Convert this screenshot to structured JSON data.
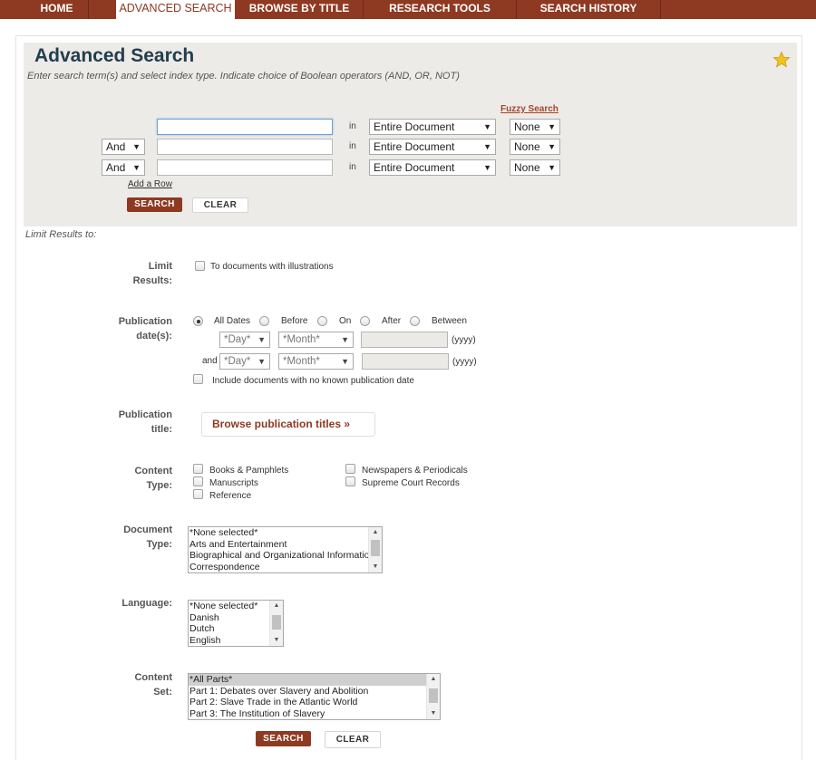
{
  "nav": {
    "tabs": [
      {
        "label": "HOME"
      },
      {
        "label": "ADVANCED SEARCH"
      },
      {
        "label": "BROWSE BY TITLE"
      },
      {
        "label": "RESEARCH TOOLS"
      },
      {
        "label": "SEARCH HISTORY"
      }
    ]
  },
  "header": {
    "title": "Advanced Search",
    "subtitle": "Enter search term(s) and select index type. Indicate choice of Boolean operators (AND, OR, NOT)"
  },
  "search": {
    "fuzzy_label": "Fuzzy Search",
    "rows": [
      {
        "operator": "",
        "term": "",
        "in_label": "in",
        "index": "Entire Document",
        "fuzzy": "None"
      },
      {
        "operator": "And",
        "term": "",
        "in_label": "in",
        "index": "Entire Document",
        "fuzzy": "None"
      },
      {
        "operator": "And",
        "term": "",
        "in_label": "in",
        "index": "Entire Document",
        "fuzzy": "None"
      }
    ],
    "add_row_label": "Add a Row",
    "search_label": "SEARCH",
    "clear_label": "CLEAR"
  },
  "limits": {
    "caption": "Limit Results to:",
    "limit_results": {
      "label_line1": "Limit",
      "label_line2": "Results:",
      "illustrations_label": "To documents with illustrations"
    },
    "publication_date": {
      "label_line1": "Publication",
      "label_line2": "date(s):",
      "options": [
        "All Dates",
        "Before",
        "On",
        "After",
        "Between"
      ],
      "selected": "All Dates",
      "day_placeholder": "*Day*",
      "month_placeholder": "*Month*",
      "year_hint": "(yyyy)",
      "and_label": "and",
      "no_date_label": "Include documents with no known publication date"
    },
    "publication_title": {
      "label_line1": "Publication",
      "label_line2": "title:",
      "browse_label": "Browse publication titles »"
    },
    "content_type": {
      "label_line1": "Content",
      "label_line2": "Type:",
      "options_left": [
        "Books & Pamphlets",
        "Manuscripts",
        "Reference"
      ],
      "options_right": [
        "Newspapers & Periodicals",
        "Supreme Court Records"
      ]
    },
    "document_type": {
      "label_line1": "Document",
      "label_line2": "Type:",
      "options": [
        "*None selected*",
        "Arts and Entertainment",
        "Biographical and Organizational Information",
        "Correspondence"
      ]
    },
    "language": {
      "label": "Language:",
      "options": [
        "*None selected*",
        "Danish",
        "Dutch",
        "English"
      ]
    },
    "content_set": {
      "label_line1": "Content",
      "label_line2": "Set:",
      "options": [
        "*All Parts*",
        "Part 1: Debates over Slavery and Abolition",
        "Part 2: Slave Trade in the Atlantic World",
        "Part 3: The Institution of Slavery"
      ],
      "selected": "*All Parts*"
    },
    "search_label": "SEARCH",
    "clear_label": "CLEAR"
  },
  "colors": {
    "nav_bg": "#8e3a22",
    "title": "#223e4f",
    "accent": "#a5432a",
    "search_panel_bg": "#edebe7",
    "star": "#f2c31c"
  },
  "icons": {
    "favorite": "star-icon"
  }
}
